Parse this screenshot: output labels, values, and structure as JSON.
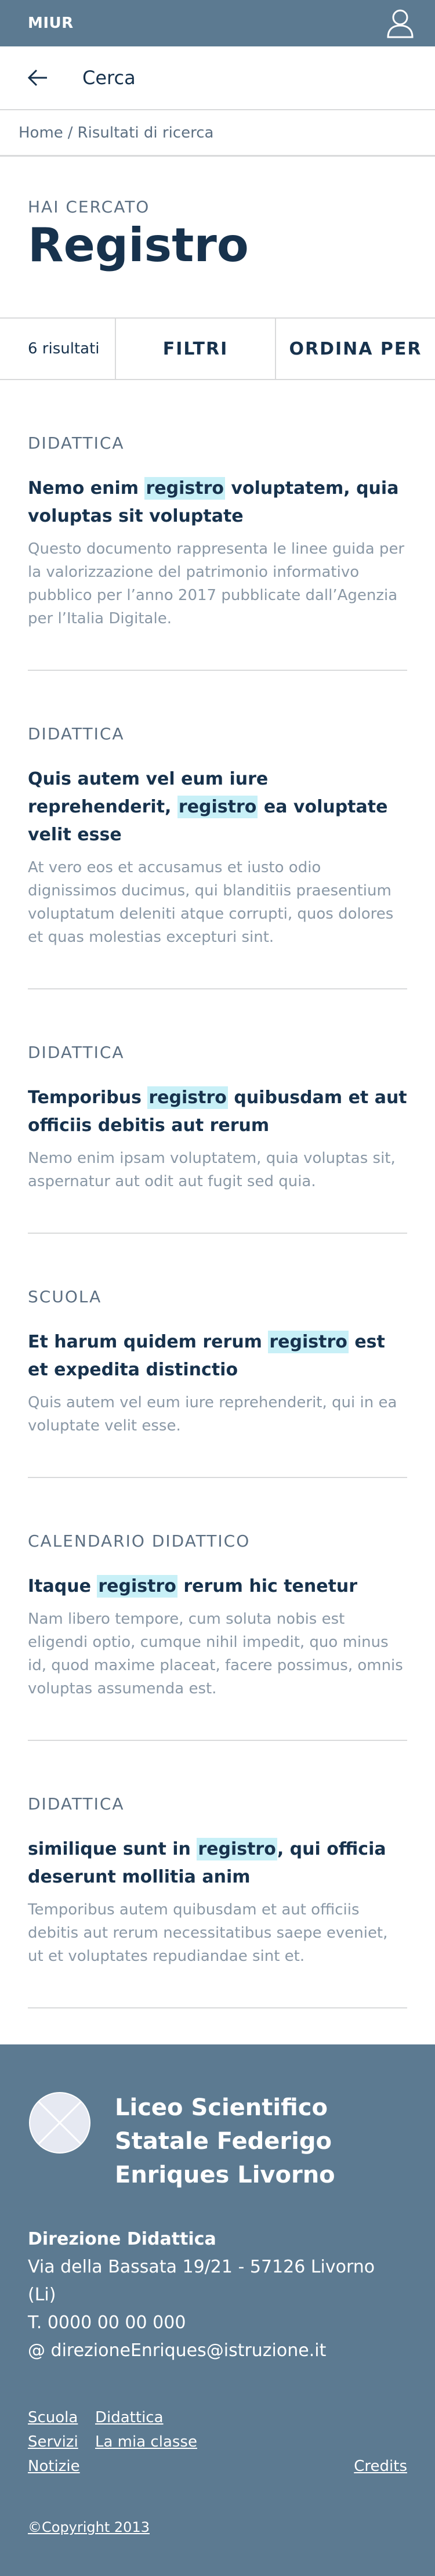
{
  "header": {
    "brand": "MIUR",
    "user_icon": "user-icon"
  },
  "search": {
    "back_icon": "arrow-left-icon",
    "label": "Cerca"
  },
  "breadcrumb": {
    "home": "Home",
    "separator": "/",
    "current": "Risultati di ricerca"
  },
  "results_head": {
    "kicker": "HAI CERCATO",
    "term": "Registro"
  },
  "toolbar": {
    "count": "6 risultati",
    "filters": "FILTRI",
    "sort": "ORDINA PER"
  },
  "results": [
    {
      "category": "DIDATTICA",
      "title_before": "Nemo enim ",
      "title_highlight": "registro",
      "title_after": " voluptatem, quia voluptas sit voluptate",
      "excerpt": "Questo documento rappresenta le linee guida per la valorizzazione del patrimonio informativo pubblico per l’anno 2017 pubblicate dall’Agenzia per l’Italia Digitale."
    },
    {
      "category": "DIDATTICA",
      "title_before": "Quis autem vel eum iure reprehenderit, ",
      "title_highlight": "registro",
      "title_after": " ea voluptate velit esse",
      "excerpt": "At vero eos et accusamus et iusto odio dignissimos ducimus, qui blanditiis praesentium voluptatum deleniti atque corrupti, quos dolores et quas molestias excepturi sint."
    },
    {
      "category": "DIDATTICA",
      "title_before": "Temporibus ",
      "title_highlight": "registro",
      "title_after": " quibusdam et aut officiis debitis aut rerum",
      "excerpt": "Nemo enim ipsam voluptatem, quia voluptas sit, aspernatur aut odit aut fugit sed quia."
    },
    {
      "category": "SCUOLA",
      "title_before": "Et harum quidem rerum ",
      "title_highlight": "registro",
      "title_after": " est et expedita distinctio",
      "excerpt": "Quis autem vel eum iure reprehenderit, qui in ea voluptate velit esse."
    },
    {
      "category": "CALENDARIO DIDATTICO",
      "title_before": "Itaque ",
      "title_highlight": "registro",
      "title_after": " rerum hic tenetur",
      "excerpt": "Nam libero tempore, cum soluta nobis est eligendi optio, cumque nihil impedit, quo minus id, quod maxime placeat, facere possimus, omnis voluptas assumenda est."
    },
    {
      "category": "DIDATTICA",
      "title_before": "similique sunt in ",
      "title_highlight": "registro",
      "title_after": ", qui officia deserunt mollitia anim",
      "excerpt": "Temporibus autem quibusdam et aut officiis debitis aut rerum necessitatibus saepe eveniet, ut et voluptates repudiandae sint et."
    }
  ],
  "footer": {
    "logo_icon": "logo-placeholder-icon",
    "org_name": "Liceo Scientifico Statale Federigo Enriques Livorno",
    "contacts_heading": "Direzione Didattica",
    "address": "Via della Bassata 19/21 - 57126 Livorno (Li)",
    "phone": "T. 0000 00 00 000",
    "email": "@ direzioneEnriques@istruzione.it",
    "links": {
      "scuola": "Scuola",
      "didattica": "Didattica",
      "servizi": "Servizi",
      "la_mia_classe": "La mia classe",
      "notizie": "Notizie",
      "credits": "Credits"
    },
    "copyright": "©Copyright 2013"
  },
  "colors": {
    "header_bg": "#5c7a91",
    "text_dark": "#17324d",
    "text_muted": "#8a98a6",
    "highlight": "#c8f0f7",
    "divider": "#d9dadb"
  }
}
